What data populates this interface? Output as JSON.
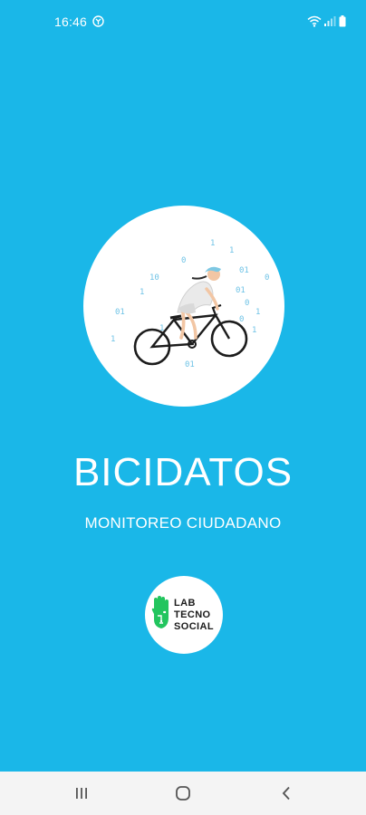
{
  "colors": {
    "background": "#1ab7e8",
    "circle": "#ffffff",
    "nav_bar": "#f4f4f4",
    "logo_green": "#22c55e"
  },
  "status_bar": {
    "time": "16:46",
    "icons": [
      "app-notification-icon",
      "wifi-icon",
      "signal-icon",
      "battery-icon"
    ]
  },
  "splash": {
    "title": "BICIDATOS",
    "subtitle": "MONITOREO CIUDADANO",
    "illustration": "cyclist-icon",
    "logo": {
      "line1": "LAB",
      "line2": "TECNO",
      "line3": "SOCIAL",
      "icon": "hand-circuit-icon"
    }
  },
  "nav_bar": {
    "buttons": [
      "recent-apps-icon",
      "home-icon",
      "back-icon"
    ]
  }
}
